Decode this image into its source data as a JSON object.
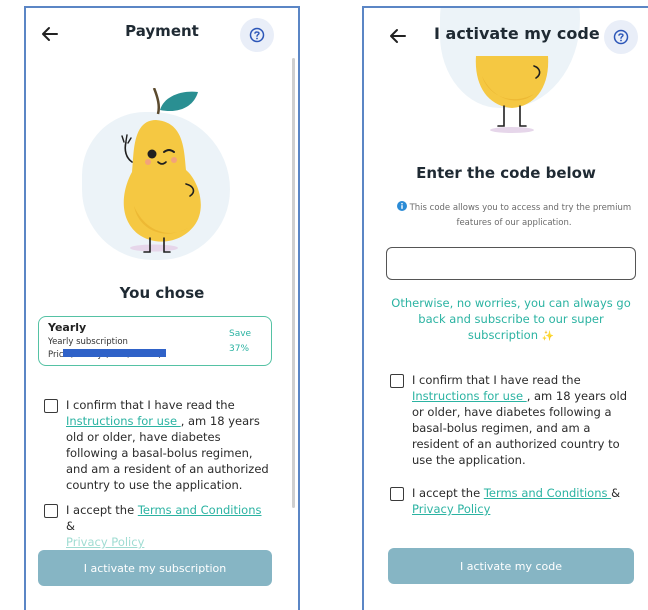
{
  "left": {
    "header": {
      "title": "Payment"
    },
    "heading": "You chose",
    "plan": {
      "name": "Yearly",
      "subtitle": "Yearly subscription",
      "price_text": "Price / Yearly (Euro/month)",
      "save_label": "Save",
      "save_value": "37%"
    },
    "consent": {
      "part1": "I confirm that I have read the ",
      "link": "Instructions for use ",
      "part2": ", am 18 years old or older, have diabetes following a basal-bolus regimen, and am a resident of an authorized country to use the application."
    },
    "terms": {
      "part1": "I accept the ",
      "terms_link": "Terms and Conditions ",
      "amp": "&",
      "privacy_link": "Privacy Policy"
    },
    "button_label": "I activate my subscription"
  },
  "right": {
    "header": {
      "title": "I activate my code"
    },
    "heading": "Enter the code below",
    "info_text": "This code allows you to access and try the premium features of our application.",
    "code_input": {
      "value": "",
      "placeholder": ""
    },
    "otherwise_text": "Otherwise, no worries, you can always go back and subscribe to our super subscription",
    "sparkle": "✨",
    "consent": {
      "part1": "I confirm that I have read the ",
      "link": "Instructions for use ",
      "part2": ", am 18 years old or older, have diabetes following a basal-bolus regimen, and am a resident of an authorized country to use the application."
    },
    "terms": {
      "part1": "I accept the ",
      "terms_link": "Terms and Conditions ",
      "amp": "&",
      "privacy_link": "Privacy Policy"
    },
    "button_label": "I activate my code"
  },
  "icons": {
    "back": "arrow-left-icon",
    "help": "question-circle-icon",
    "info": "info-circle-icon",
    "mascot": "pear-mascot-icon",
    "sparkle": "sparkle-icon"
  },
  "colors": {
    "teal": "#2bb3a2",
    "card_border": "#55c2a4",
    "button": "#86b5c4",
    "frame": "#5b86c5",
    "help_bg": "#e9eef8",
    "blob": "#ecf3f8",
    "info_blue": "#2b8bd6",
    "redaction": "#2f62c8"
  }
}
